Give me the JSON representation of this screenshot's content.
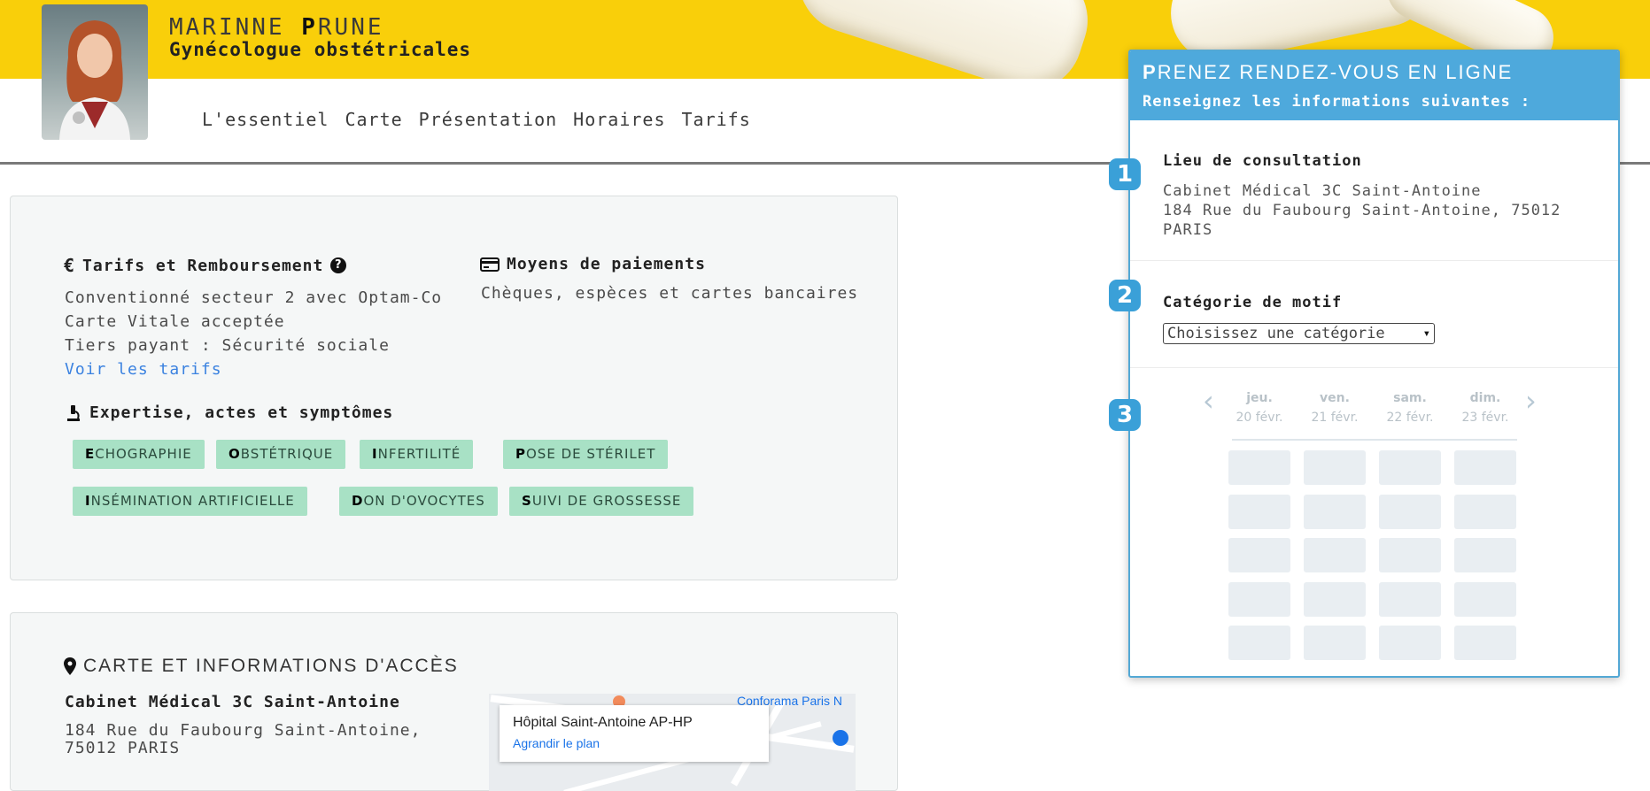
{
  "doctor": {
    "name_first": "MARINNE",
    "name_last_initial": "P",
    "name_last_rest": "RUNE",
    "specialty": "Gynécologue obstétricales"
  },
  "nav": [
    "L'essentiel",
    "Carte",
    "Présentation",
    "Horaires",
    "Tarifs"
  ],
  "tarifs": {
    "title": "Tarifs et Remboursement",
    "lines": [
      "Conventionné secteur 2 avec Optam-Co",
      "Carte Vitale acceptée",
      "Tiers payant : Sécurité sociale"
    ],
    "link": "Voir les tarifs"
  },
  "paiements": {
    "title": "Moyens de paiements",
    "text": "Chèques, espèces et cartes bancaires"
  },
  "expertise": {
    "title": "Expertise, actes et symptômes",
    "tags": [
      "ECHOGRAPHIE",
      "OBSTÉTRIQUE",
      "INFERTILITÉ",
      "POSE DE STÉRILET",
      "INSÉMINATION ARTIFICIELLE",
      "DON D'OVOCYTES",
      "SUIVI DE GROSSESSE"
    ]
  },
  "access": {
    "title": "CARTE ET INFORMATIONS D'ACCÈS",
    "cabinet": "Cabinet Médical 3C Saint-Antoine",
    "address1": "184 Rue du Faubourg Saint-Antoine,",
    "address2": "75012 PARIS"
  },
  "map": {
    "popup_title": "Hôpital Saint-Antoine AP-HP",
    "popup_link": "Agrandir le plan",
    "label": "Conforama Paris N"
  },
  "booking": {
    "title_initial": "P",
    "title_rest": "RENEZ RENDEZ-VOUS EN LIGNE",
    "subtitle": "Renseignez les informations suivantes :",
    "steps": [
      "1",
      "2",
      "3"
    ],
    "lieu_title": "Lieu de consultation",
    "lieu_lines": [
      "Cabinet Médical 3C Saint-Antoine",
      "184 Rue du Faubourg Saint-Antoine, 75012",
      "PARIS"
    ],
    "motif_title": "Catégorie de motif",
    "motif_select": "Choisissez une catégorie",
    "days": [
      {
        "name": "jeu.",
        "date": "20 févr."
      },
      {
        "name": "ven.",
        "date": "21 févr."
      },
      {
        "name": "sam.",
        "date": "22 févr."
      },
      {
        "name": "dim.",
        "date": "23 févr."
      }
    ],
    "slot_rows": 5
  },
  "colors": {
    "banner": "#f9cf0a",
    "panel_header": "#4ea9dc",
    "tag_bg": "#a8e1c5",
    "link": "#3b82e0"
  }
}
